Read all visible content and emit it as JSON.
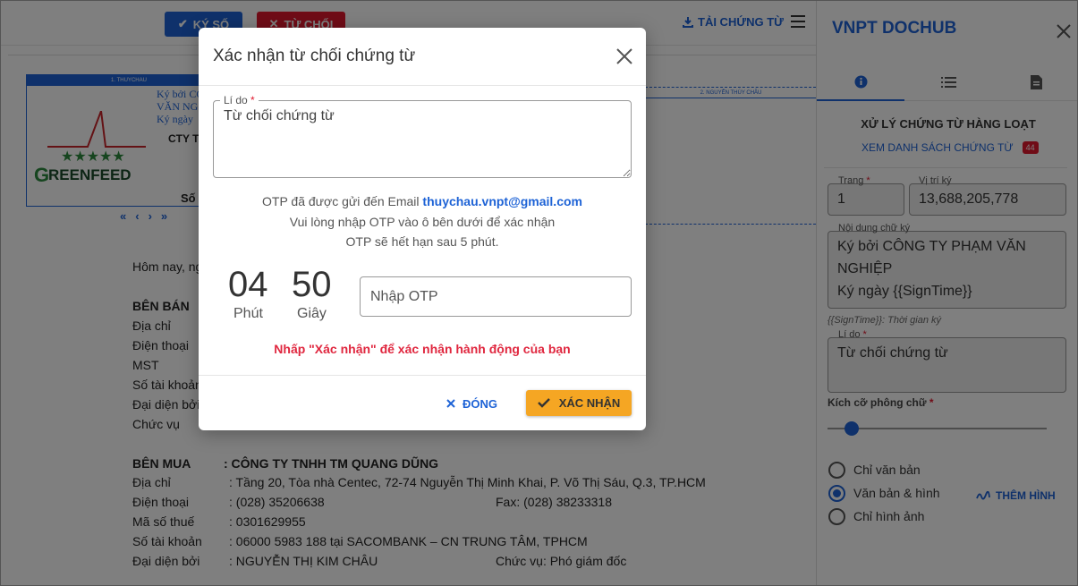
{
  "toolbar": {
    "sign_label": "KÝ SỐ",
    "reject_label": "TỪ CHỐI",
    "download_label": "TẢI CHỨNG TỪ"
  },
  "signature_block": {
    "header_1": "1. THUYCHAU",
    "header_2": "2. NGUYỄN THÚY CHÂU",
    "logo_text": "GREENFEED",
    "line_1": "Ký bởi CÔ",
    "line_2": "VĂN NG",
    "line_3": "Ký ngày",
    "company_partial": "CTY T",
    "so_partial": "Số"
  },
  "document": {
    "intro": "Hôm nay, ng",
    "seller_heading": "BÊN BÁN",
    "seller_rows": [
      "Địa chỉ",
      "Điện thoại",
      "MST",
      "Số tài khoản",
      "Đại diện bởi",
      "Chức vụ"
    ],
    "buyer_heading": "BÊN MUA",
    "buyer_name": ": CÔNG TY TNHH TM QUANG DŨNG",
    "buyer_rows": [
      {
        "label": "Địa chỉ",
        "value": ": Tầng 20, Tòa nhà Centec, 72-74 Nguyễn Thị Minh Khai, P. Võ Thị Sáu, Q.3, TP.HCM",
        "extra": ""
      },
      {
        "label": "Điện thoại",
        "value": ": (028) 35206638",
        "extra": "Fax: (028) 38233318"
      },
      {
        "label": "Mã số thuế",
        "value": ": 0301629955",
        "extra": ""
      },
      {
        "label": "Số tài khoản",
        "value": ": 06000 5983 188 tại SACOMBANK – CN TRUNG TÂM, TPHCM",
        "extra": ""
      },
      {
        "label": "Đại diện bởi",
        "value": ": NGUYỄN THỊ KIM CHÂU",
        "extra": "Chức vụ: Phó giám đốc"
      }
    ]
  },
  "panel": {
    "title": "VNPT DOCHUB",
    "subtitle": "XỬ LÝ CHỨNG TỪ HÀNG LOẠT",
    "list_link": "XEM DANH SÁCH CHỨNG TỪ",
    "list_count": "44",
    "page_label": "Trang",
    "page_value": "1",
    "position_label": "Vị trí ký",
    "position_value": "13,688,205,778",
    "content_label": "Nội dung chữ ký",
    "content_line_1": "Ký bởi CÔNG TY PHẠM VĂN",
    "content_line_2": "NGHIỆP",
    "content_line_3": "Ký ngày {{SignTime}}",
    "hint": "{{SignTime}}: Thời gian ký",
    "reason_label": "Lí do",
    "reason_value": "Từ chối chứng từ",
    "font_size_label": "Kích cỡ phông chữ",
    "font_size_level": 0.08,
    "radio_1": "Chỉ văn bản",
    "radio_2": "Văn bản & hình",
    "radio_3": "Chỉ hình ảnh",
    "radio_selected": "Văn bản & hình",
    "add_image": "THÊM HÌNH"
  },
  "modal": {
    "title": "Xác nhận từ chối chứng từ",
    "reason_label": "Lí do",
    "reason_value": "Từ chối chứng từ",
    "otp_sent_prefix": "OTP đã được gửi đến Email ",
    "otp_email": "thuychau.vnpt@gmail.com",
    "otp_instruction": "Vui lòng nhập OTP vào ô bên dưới để xác nhận",
    "otp_expire": "OTP sẽ hết hạn sau 5 phút.",
    "minutes": "04",
    "minutes_label": "Phút",
    "seconds": "50",
    "seconds_label": "Giây",
    "otp_placeholder": "Nhập OTP",
    "warning": "Nhấp \"Xác nhận\" để xác nhận hành động của bạn",
    "close_label": "ĐÓNG",
    "confirm_label": "XÁC NHẬN"
  },
  "colors": {
    "primary": "#1e63d6",
    "danger": "#e0192e",
    "confirm": "#f5a623"
  }
}
